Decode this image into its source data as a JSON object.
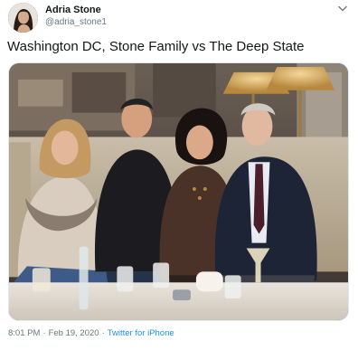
{
  "author": {
    "name": "Adria Stone",
    "handle": "@adria_stone1"
  },
  "tweet": {
    "text": "Washington DC, Stone Family vs The Deep State",
    "time": "8:01 PM",
    "separator": "·",
    "date": "Feb 19, 2020",
    "source": "Twitter for iPhone"
  },
  "icons": {
    "menu": "chevron-down-icon"
  },
  "colors": {
    "text": "#14171a",
    "secondary": "#657786",
    "link": "#1b95e0"
  }
}
